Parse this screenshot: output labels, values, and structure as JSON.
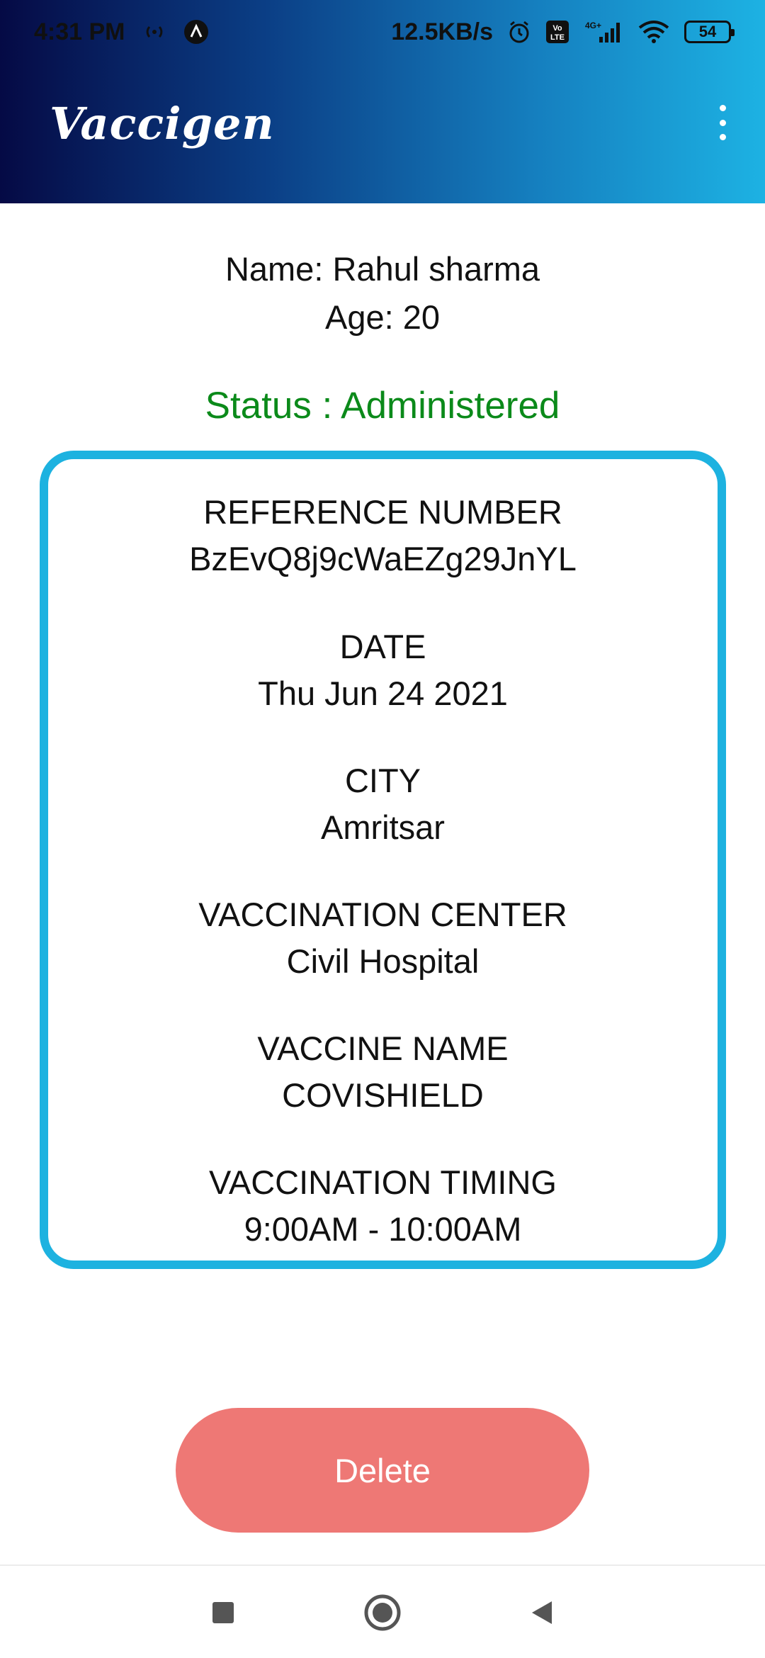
{
  "status_bar": {
    "time": "4:31 PM",
    "network_speed": "12.5KB/s",
    "network_type": "4G+",
    "volte": "Vo LTE",
    "battery": "54"
  },
  "app_bar": {
    "title": "Vaccigen",
    "menu_icon": "kebab-menu-icon"
  },
  "person": {
    "name_text": "Name: Rahul sharma",
    "age_text": "Age: 20"
  },
  "status": {
    "text": "Status : Administered",
    "color": "#0b8a1a"
  },
  "details": [
    {
      "label": "REFERENCE NUMBER",
      "value": "BzEvQ8j9cWaEZg29JnYL"
    },
    {
      "label": "DATE",
      "value": "Thu Jun 24 2021"
    },
    {
      "label": "CITY",
      "value": "Amritsar"
    },
    {
      "label": "VACCINATION CENTER",
      "value": "Civil Hospital"
    },
    {
      "label": "VACCINE NAME",
      "value": "COVISHIELD"
    },
    {
      "label": "VACCINATION TIMING",
      "value": "9:00AM - 10:00AM"
    }
  ],
  "actions": {
    "delete_label": "Delete",
    "delete_color": "#ee7875"
  },
  "colors": {
    "accent": "#1db2e0",
    "header_start": "#050a45",
    "header_end": "#1db2e3"
  },
  "nav_bar": {
    "recents_icon": "square-recents-icon",
    "home_icon": "circle-home-icon",
    "back_icon": "triangle-back-icon"
  }
}
